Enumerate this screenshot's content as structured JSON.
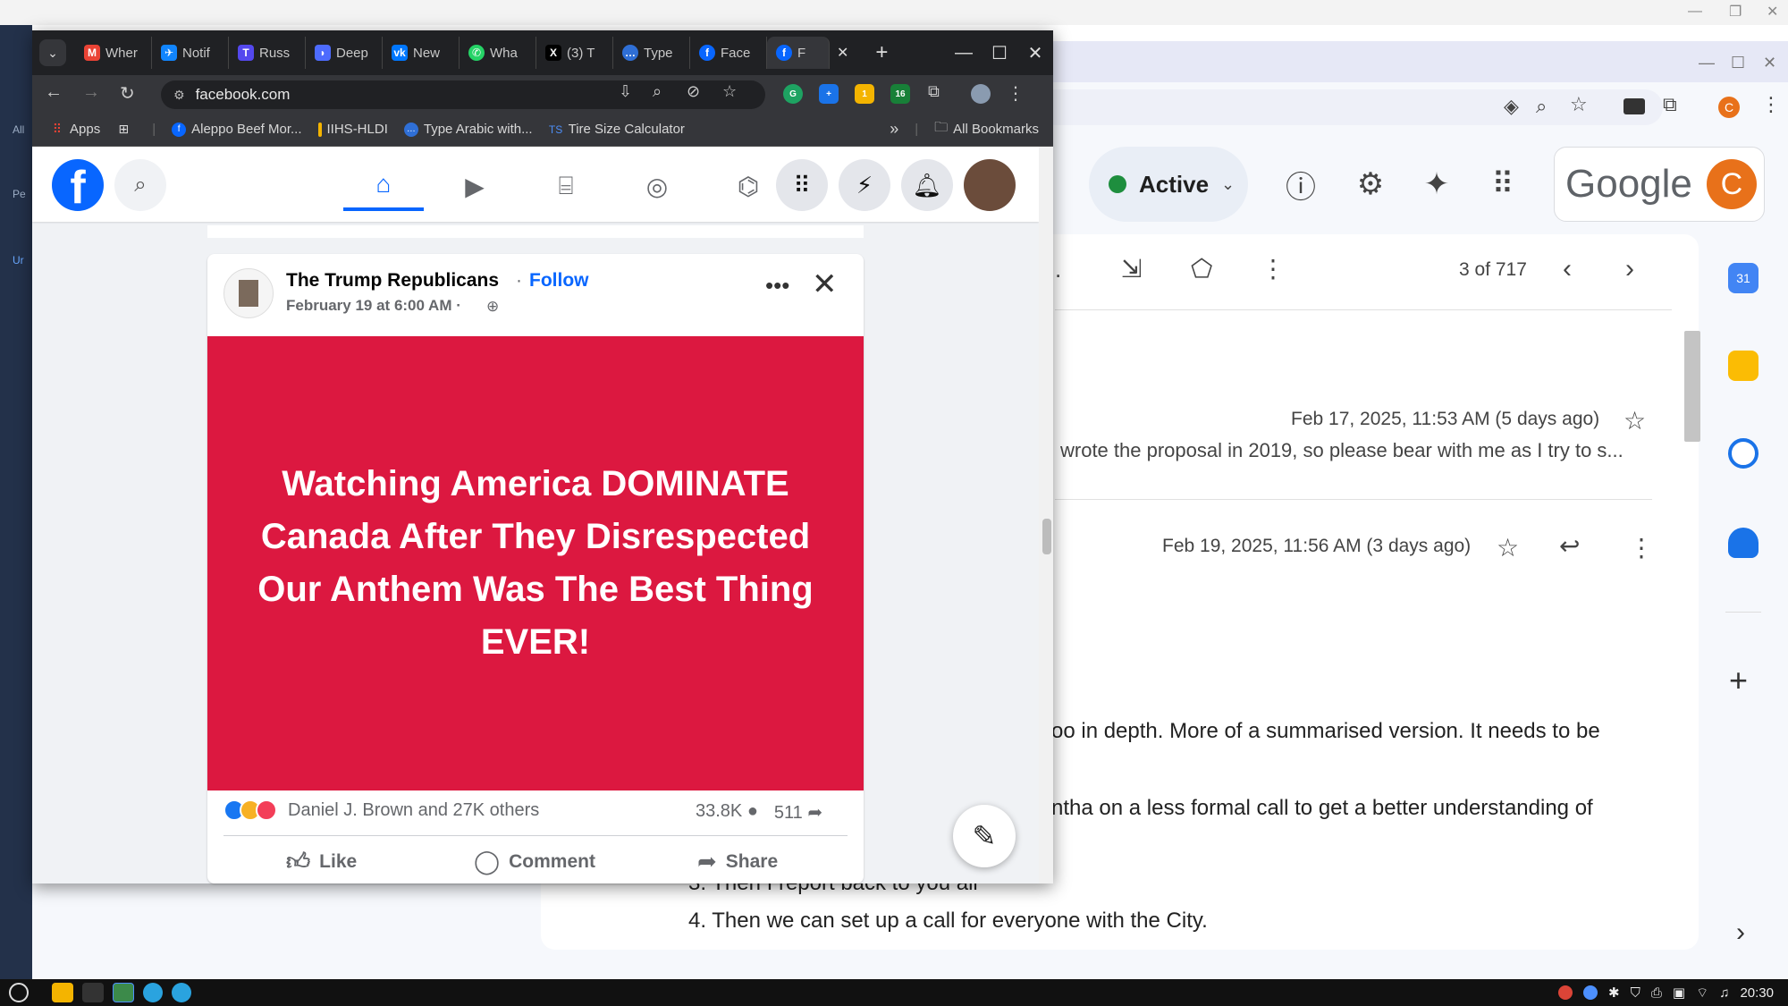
{
  "facebook_window": {
    "tabs": [
      {
        "label": "Wher",
        "icon": "gmail-icon",
        "color": "#ea4335"
      },
      {
        "label": "Notif",
        "icon": "bluesky-icon",
        "color": "#1185fe"
      },
      {
        "label": "Russ",
        "icon": "truth-icon",
        "color": "#5448ee"
      },
      {
        "label": "Deep",
        "icon": "deepseek-icon",
        "color": "#4d6bfe"
      },
      {
        "label": "New",
        "icon": "vk-icon",
        "color": "#0077ff"
      },
      {
        "label": "Wha",
        "icon": "whatsapp-icon",
        "color": "#25d366"
      },
      {
        "label": "(3) T",
        "icon": "x-icon",
        "color": "#000000"
      },
      {
        "label": "Type",
        "icon": "chat-icon",
        "color": "#2f6fd6"
      },
      {
        "label": "Face",
        "icon": "facebook-icon",
        "color": "#0866ff"
      },
      {
        "label": "F",
        "icon": "facebook-icon",
        "color": "#0866ff"
      }
    ],
    "tab_close": "✕",
    "new_tab": "+",
    "url": "facebook.com",
    "bookmarks": [
      {
        "label": "Apps",
        "icon": "apps-grid-icon"
      },
      {
        "label": "",
        "icon": "grid-icon"
      },
      {
        "label": "Aleppo Beef Mor...",
        "icon": "facebook-icon"
      },
      {
        "label": "IIHS-HLDI",
        "icon": "iihs-icon"
      },
      {
        "label": "Type Arabic with...",
        "icon": "chat-icon"
      },
      {
        "label": "Tire Size Calculator",
        "icon": "ts-icon"
      }
    ],
    "bookmarks_more": "»",
    "all_bookmarks": "All Bookmarks",
    "ext_badges": {
      "green": "1",
      "sixteen": "16"
    }
  },
  "post": {
    "author": "The Trump Republicans",
    "separator": "·",
    "follow": "Follow",
    "date": "February 19 at 6:00 AM ·",
    "image_text": "Watching America DOMINATE Canada After They Disrespected Our Anthem Was The Best Thing EVER!",
    "image_color": "#dc1840",
    "reactions_text": "Daniel J. Brown and 27K others",
    "comments": "33.8K",
    "shares": "511",
    "actions": {
      "like": "Like",
      "comment": "Comment",
      "share": "Share"
    }
  },
  "gmail": {
    "status": "Active",
    "google_word": "Google",
    "avatar_letter": "C",
    "count": "3 of 717",
    "email1": {
      "date": "Feb 17, 2025, 11:53 AM (5 days ago)",
      "preview": "wrote the proposal in 2019, so please bear with me as I try to s..."
    },
    "email2": {
      "date": "Feb 19, 2025, 11:56 AM (3 days ago)",
      "line1": "oo in depth. More of a summarised version. It needs to be",
      "line2": "ntha on a less formal call to get a better understanding of",
      "line3": "3. Then I report back to you all",
      "line4": "4. Then we can set up a call for everyone with the City."
    }
  },
  "desktop": {
    "left_labels": [
      "All",
      "Pe",
      "Ur"
    ],
    "clock": "20:30"
  }
}
